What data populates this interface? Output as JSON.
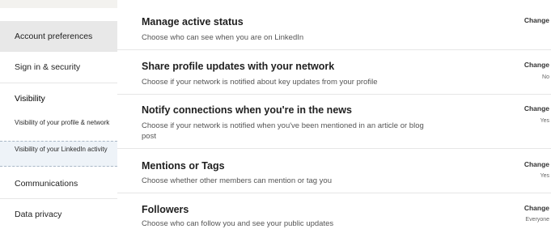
{
  "sidebar": {
    "items": [
      {
        "label": "Account preferences"
      },
      {
        "label": "Sign in & security"
      },
      {
        "label": "Visibility"
      },
      {
        "label": "Communications"
      },
      {
        "label": "Data privacy"
      }
    ],
    "visibility_subitems": [
      {
        "label": "Visibility of your profile & network"
      },
      {
        "label": "Visibility of your LinkedIn activity"
      }
    ]
  },
  "settings": [
    {
      "title": "Manage active status",
      "description": "Choose who can see when you are on LinkedIn",
      "action": "Change",
      "value": ""
    },
    {
      "title": "Share profile updates with your network",
      "description": "Choose if your network is notified about key updates from your profile",
      "action": "Change",
      "value": "No"
    },
    {
      "title": "Notify connections when you're in the news",
      "description": "Choose if your network is notified when you've been mentioned in an article or blog post",
      "action": "Change",
      "value": "Yes"
    },
    {
      "title": "Mentions or Tags",
      "description": "Choose whether other members can mention or tag you",
      "action": "Change",
      "value": "Yes"
    },
    {
      "title": "Followers",
      "description": "Choose who can follow you and see your public updates",
      "action": "Change",
      "value": "Everyone"
    }
  ],
  "colors": {
    "background": "#f3f2ef",
    "panel": "#ffffff",
    "active_item": "#e8e8e8",
    "selected_subitem": "#eef3f8"
  }
}
